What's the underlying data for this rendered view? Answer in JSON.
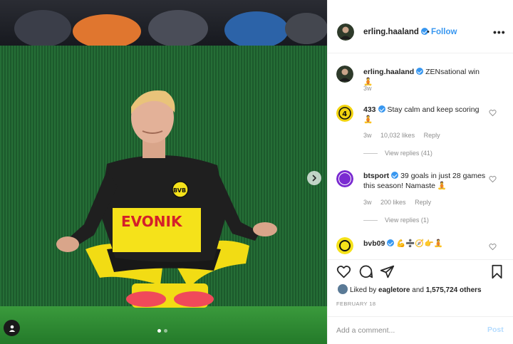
{
  "post": {
    "username": "erling.haaland",
    "follow_label": "Follow",
    "separator": "•",
    "more_label": "•••",
    "carousel": {
      "total": 2,
      "active": 1
    }
  },
  "caption": {
    "username": "erling.haaland",
    "text": "ZENsational win 🧘",
    "time": "3w"
  },
  "comments": [
    {
      "username": "433",
      "text": "Stay calm and keep scoring 🧘",
      "time": "3w",
      "likes": "10,032 likes",
      "reply_label": "Reply",
      "view_replies": "View replies (41)"
    },
    {
      "username": "btsport",
      "text": "39 goals in just 28 games this season! Namaste 🧘",
      "time": "3w",
      "likes": "200 likes",
      "reply_label": "Reply",
      "view_replies": "View replies (1)"
    },
    {
      "username": "bvb09",
      "text": "💪➗🧭👉🧘",
      "time": "",
      "likes": "",
      "reply_label": "",
      "view_replies": ""
    }
  ],
  "likes": {
    "prefix": "Liked by",
    "first_user": "eagletore",
    "joiner": "and",
    "others": "1,575,724 others"
  },
  "date": "FEBRUARY 18",
  "add_comment": {
    "placeholder": "Add a comment...",
    "post_label": "Post"
  },
  "photo": {
    "sponsor_text": "EVONIK",
    "club_badge_text": "BVB",
    "verified_color": "#3897f0",
    "link_color": "#3897f0",
    "kit_color": "#f5e21a",
    "pitch_color": "#1e7a2a"
  },
  "icons": [
    "heart-icon",
    "comment-icon",
    "share-icon",
    "bookmark-icon",
    "more-icon",
    "tag-person-icon",
    "chevron-right-icon"
  ]
}
